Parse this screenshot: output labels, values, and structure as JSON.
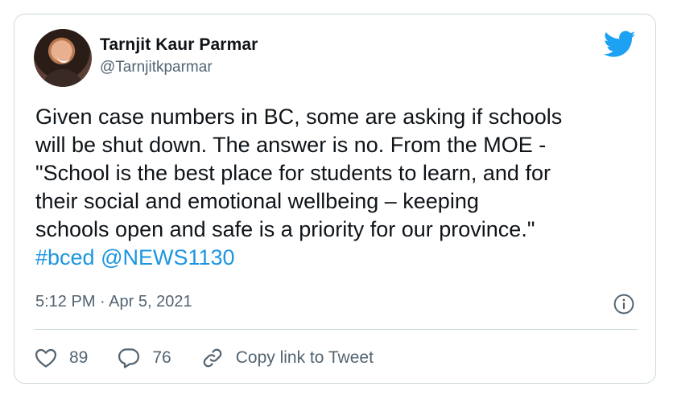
{
  "user": {
    "name": "Tarnjit Kaur Parmar",
    "handle": "@Tarnjitkparmar"
  },
  "tweet": {
    "lines": [
      "Given case numbers in BC, some are asking if schools",
      "will be shut down. The answer is no. From the MOE -",
      "\"School is the best place for students to learn, and for",
      "their social and emotional wellbeing – keeping",
      "schools open and safe is a priority for our province.\""
    ],
    "hashtag": "#bced",
    "mention": "@NEWS1130",
    "timestamp": "5:12 PM · Apr 5, 2021"
  },
  "actions": {
    "likes": "89",
    "replies": "76",
    "copy_link": "Copy link to Tweet"
  },
  "icons": {
    "brand": "twitter-bird-icon",
    "info": "info-icon",
    "like": "heart-icon",
    "reply": "reply-icon",
    "link": "link-icon"
  },
  "colors": {
    "link": "#1b95e0",
    "twitter_blue": "#1da1f2",
    "muted": "#536471",
    "border": "#cfd9de"
  }
}
